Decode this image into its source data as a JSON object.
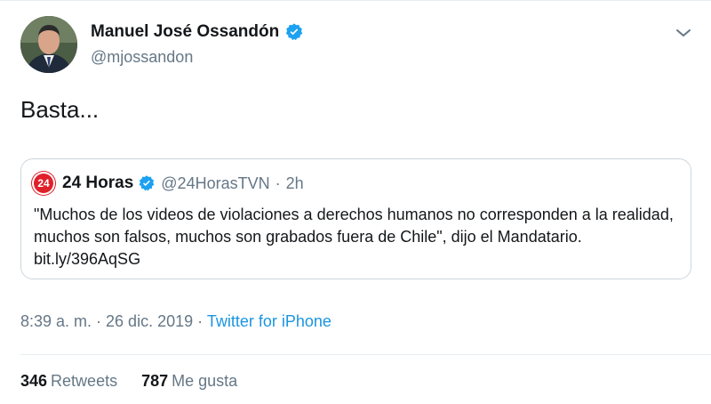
{
  "tweet": {
    "author": {
      "display_name": "Manuel José Ossandón",
      "handle": "@mjossandon",
      "verified_icon": "verified-badge-icon"
    },
    "text": "Basta...",
    "quoted": {
      "logo_text": "24",
      "display_name": "24 Horas",
      "handle": "@24HorasTVN",
      "separator": "·",
      "time": "2h",
      "text": "\"Muchos de los videos de violaciones a derechos humanos no corresponden a la realidad, muchos son falsos, muchos son grabados fuera de Chile\", dijo el Mandatario. bit.ly/396AqSG"
    },
    "meta": {
      "timestamp": "8:39 a. m. · 26 dic. 2019",
      "separator": "·",
      "source": "Twitter for iPhone"
    },
    "stats": {
      "retweets_count": "346",
      "retweets_label": "Retweets",
      "likes_count": "787",
      "likes_label": "Me gusta"
    }
  },
  "colors": {
    "link": "#1b95e0",
    "verified": "#1da1f2",
    "muted": "#657786",
    "border": "#ccd6dd",
    "brand_24horas": "#e0202b"
  }
}
